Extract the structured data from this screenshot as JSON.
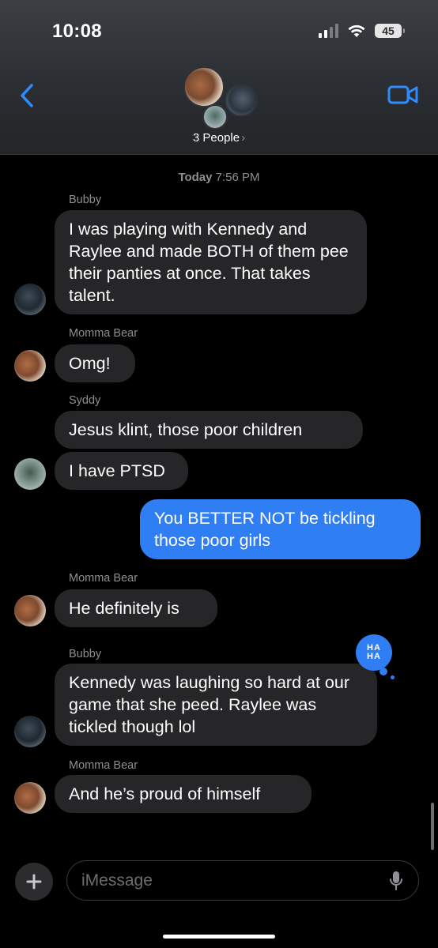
{
  "status_bar": {
    "time": "10:08",
    "battery": "45"
  },
  "header": {
    "participants_label": "3 People",
    "chevron": "›"
  },
  "conversation": {
    "timestamp_day": "Today",
    "timestamp_time": "7:56 PM",
    "messages": [
      {
        "sender": "Bubby",
        "text": "I was playing with Kennedy and Raylee and made BOTH of them pee their panties at once.  That takes talent."
      },
      {
        "sender": "Momma Bear",
        "text": "Omg!"
      },
      {
        "sender": "Syddy",
        "text": "Jesus klint, those poor children"
      },
      {
        "sender": "",
        "text": "I have PTSD"
      },
      {
        "sender": "me",
        "text": "You BETTER NOT be tickling those poor girls"
      },
      {
        "sender": "Momma Bear",
        "text": "He definitely is"
      },
      {
        "sender": "Bubby",
        "text": "Kennedy was laughing so hard at our game that she peed.  Raylee was tickled though lol"
      },
      {
        "sender": "Momma Bear",
        "text": "And he’s proud of himself"
      }
    ],
    "tapback_line1": "HA",
    "tapback_line2": "HA"
  },
  "composer": {
    "placeholder": "iMessage",
    "plus_label": "+"
  },
  "colors": {
    "incoming_bubble": "#262628",
    "outgoing_bubble": "#2f7ef3",
    "accent": "#2f7ef3"
  },
  "icons": [
    "back-chevron-icon",
    "video-camera-icon",
    "signal-icon",
    "wifi-icon",
    "battery-icon",
    "plus-icon",
    "microphone-icon"
  ]
}
